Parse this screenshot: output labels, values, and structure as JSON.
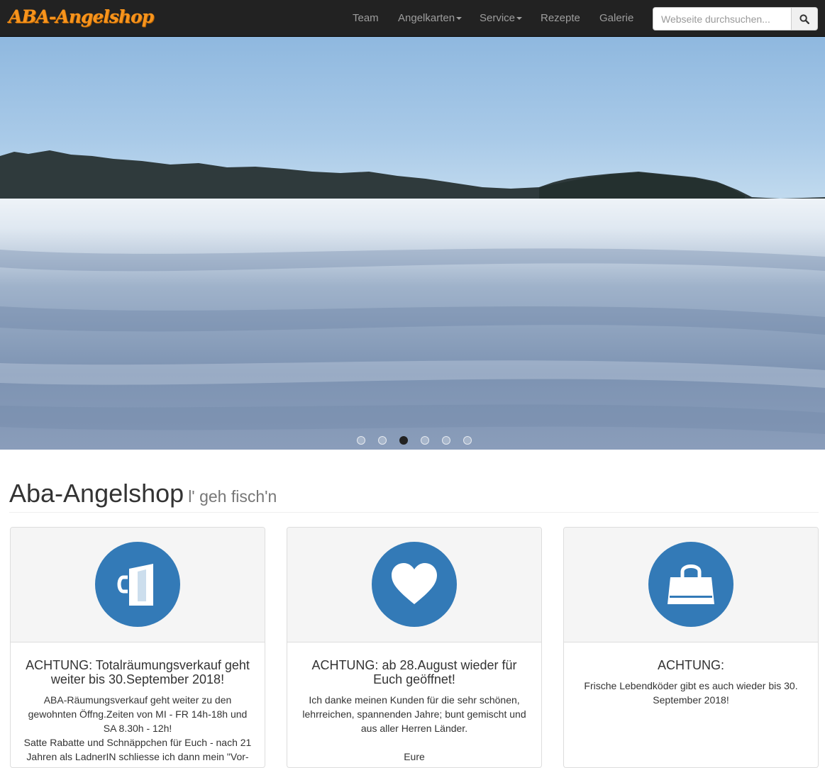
{
  "brand": "ABA-Angelshop",
  "nav": {
    "items": [
      {
        "label": "Team",
        "dropdown": false
      },
      {
        "label": "Angelkarten",
        "dropdown": true
      },
      {
        "label": "Service",
        "dropdown": true
      },
      {
        "label": "Rezepte",
        "dropdown": false
      },
      {
        "label": "Galerie",
        "dropdown": false
      }
    ],
    "search_placeholder": "Webseite durchsuchen...",
    "search_icon": "search-icon"
  },
  "carousel": {
    "slide_count": 6,
    "active_index": 2
  },
  "header": {
    "title": "Aba-Angelshop",
    "subtitle": "l' geh fisch'n"
  },
  "panels": [
    {
      "icon": "shopping-bag-door-icon",
      "title": "ACHTUNG: Totalräumungsverkauf geht weiter bis 30.September 2018!",
      "lines": [
        "ABA-Räumungsverkauf geht weiter zu den",
        "gewohnten Öffng.Zeiten von MI - FR 14h-18h und",
        "SA 8.30h - 12h!",
        "Satte Rabatte und Schnäppchen für Euch - nach 21",
        "Jahren als LadnerIN schliesse ich dann mein \"Vor-"
      ]
    },
    {
      "icon": "heart-icon",
      "title": "ACHTUNG: ab 28.August wieder für Euch geöffnet!",
      "lines": [
        "Ich danke meinen Kunden für die sehr schönen,",
        "lehrreichen, spannenden Jahre; bunt gemischt und",
        "aus aller Herren Länder.",
        "",
        "Eure"
      ]
    },
    {
      "icon": "shopping-bag-icon",
      "title": "ACHTUNG:",
      "lines": [
        "Frische Lebendköder gibt es auch wieder bis 30.",
        "September 2018!"
      ]
    }
  ],
  "colors": {
    "navbar": "#222222",
    "brand": "#f7941d",
    "accent": "#337ab7",
    "panel_heading": "#f5f5f5"
  }
}
